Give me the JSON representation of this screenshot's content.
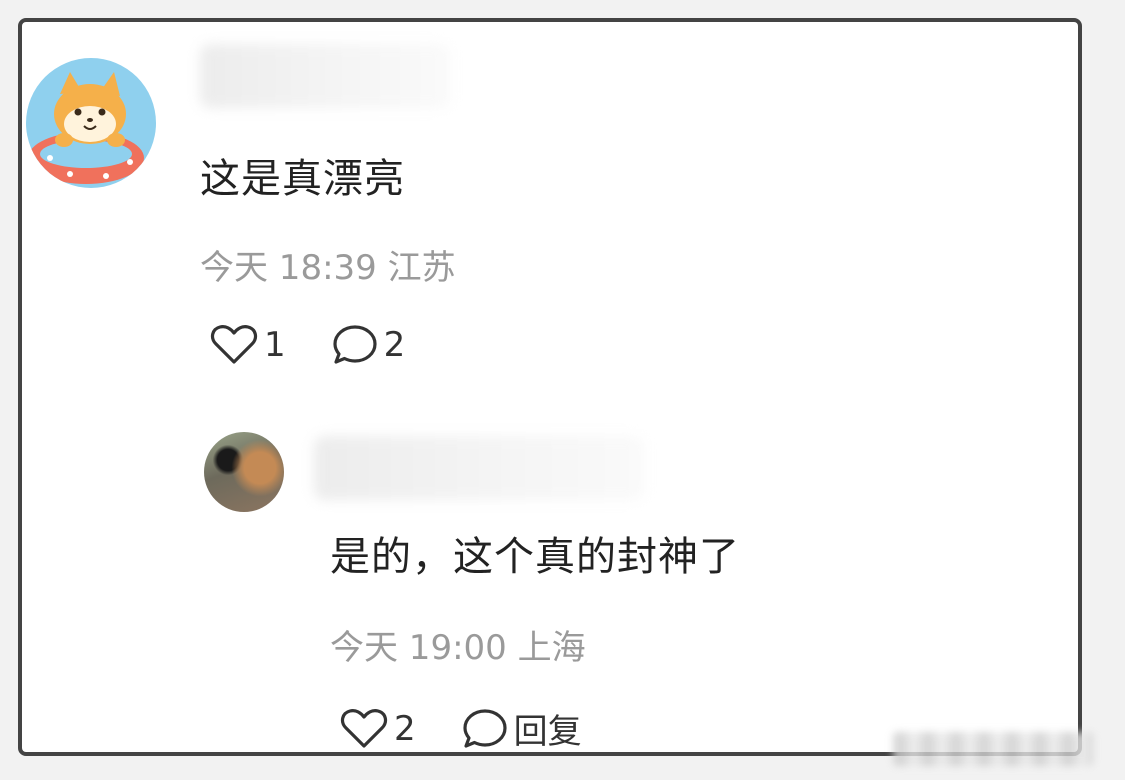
{
  "comment": {
    "avatar": "shiba-dog-in-float-ring-avatar",
    "text": "这是真漂亮",
    "meta": "今天 18:39 江苏",
    "likes": "1",
    "replies": "2",
    "reply_item": {
      "avatar": "photo-avatar",
      "text": "是的，这个真的封神了",
      "meta": "今天 19:00 上海",
      "likes": "2",
      "reply_label": "回复"
    }
  },
  "icons": {
    "like": "heart-outline-icon",
    "comment": "speech-bubble-icon"
  },
  "colors": {
    "text": "#222222",
    "meta": "#9a9a9a",
    "border": "#444444",
    "avatar_bg": "#8fd0ee"
  }
}
